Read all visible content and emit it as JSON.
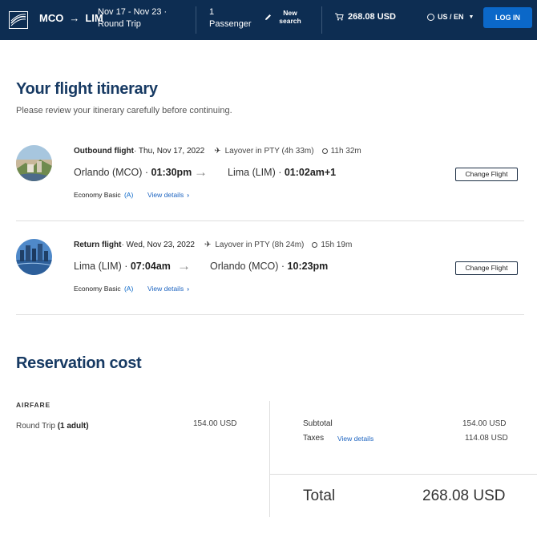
{
  "header": {
    "origin": "MCO",
    "destination": "LIM",
    "route_arrow": "→",
    "dates": "Nov 17 - Nov 23 · Round Trip",
    "passengers": "1 Passenger",
    "new_search": "New search",
    "cart_total": "268.08 USD",
    "language": "US / EN",
    "login_label": "LOG IN",
    "colors": {
      "bar": "#0d2d52",
      "login": "#0b68c9"
    }
  },
  "page": {
    "title": "Your flight itinerary",
    "subtitle": "Please review your itinerary carefully before continuing."
  },
  "flights": [
    {
      "label": "Outbound flight",
      "date": " · Thu, Nov 17, 2022",
      "layover": "Layover in PTY (4h 33m)",
      "duration": "11h 32m",
      "from_city": "Orlando (MCO) · ",
      "from_time": "01:30pm",
      "to_city": "Lima (LIM) · ",
      "to_time": "01:02am+1",
      "fare": "Economy Basic",
      "fare_code": "(A)",
      "details": "View details",
      "change": "Change Flight"
    },
    {
      "label": "Return flight",
      "date": " · Wed, Nov 23, 2022",
      "layover": "Layover in PTY (8h 24m)",
      "duration": "15h 19m",
      "from_city": "Lima (LIM) · ",
      "from_time": "07:04am",
      "to_city": "Orlando (MCO) · ",
      "to_time": "10:23pm",
      "fare": "Economy Basic",
      "fare_code": "(A)",
      "details": "View details",
      "change": "Change Flight"
    }
  ],
  "reservation": {
    "title": "Reservation cost",
    "airfare_label": "AIRFARE",
    "round_trip": "Round Trip ",
    "round_trip_pax": "(1 adult)",
    "round_trip_amount": "154.00 USD",
    "subtotal_label": "Subtotal",
    "subtotal_amount": "154.00 USD",
    "taxes_label": "Taxes",
    "taxes_details": "View details",
    "taxes_amount": "114.08 USD",
    "total_label": "Total",
    "total_amount": "268.08 USD"
  }
}
